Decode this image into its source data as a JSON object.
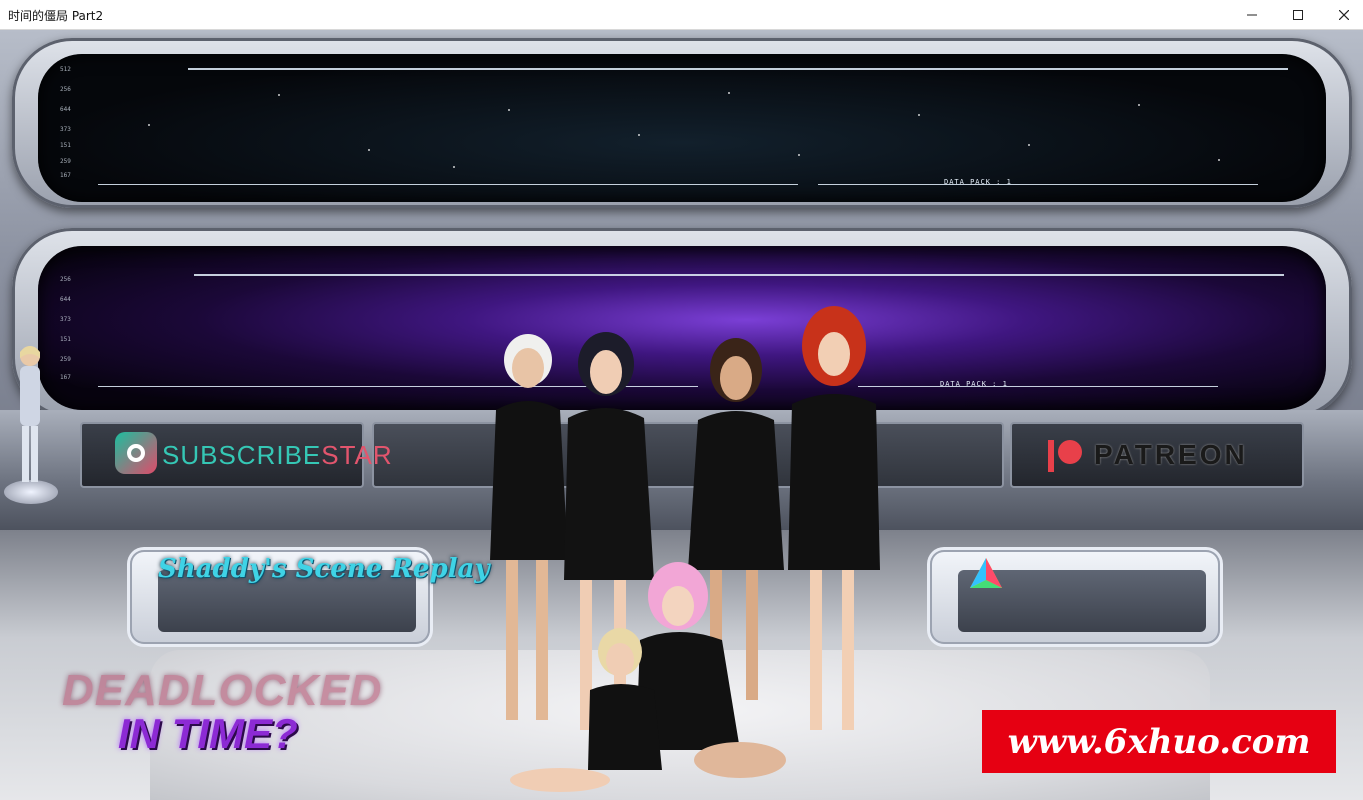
{
  "window": {
    "title": "时间的僵局 Part2",
    "minimize_icon": "minimize-icon",
    "maximize_icon": "maximize-icon",
    "close_icon": "close-icon"
  },
  "hud": {
    "top_data_pack": "DATA PACK : 1",
    "bottom_data_pack": "DATA PACK : 1",
    "scale_ticks": [
      "512",
      "256",
      "644",
      "373",
      "151",
      "259",
      "167"
    ]
  },
  "logos": {
    "subscribestar_part1": "SUBSCRIBE",
    "subscribestar_part2": "STAR",
    "patreon": "PATREON"
  },
  "menu": {
    "scene_replay_label": "Shaddy's Scene Replay",
    "gallery_icon": "prism-icon"
  },
  "game_title": {
    "line1": "DEADLOCKED",
    "line2": "IN TIME?"
  },
  "watermark": {
    "text": "www.6xhuo.com"
  },
  "colors": {
    "subscribestar_teal": "#35c7b5",
    "subscribestar_pink": "#e2556d",
    "replay_cyan": "#3fd3e6",
    "title_purple": "#8c2ad4",
    "watermark_red": "#e60012"
  }
}
